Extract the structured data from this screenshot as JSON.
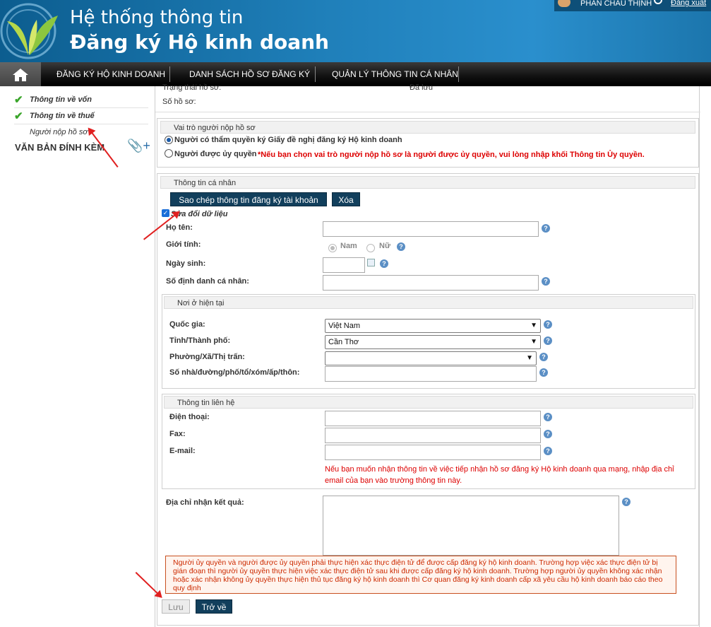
{
  "header": {
    "title_line1": "Hệ thống thông tin",
    "title_line2": "Đăng ký Hộ kinh doanh",
    "user_name": "PHAN CHÂU THỊNH",
    "logout": "Đăng xuất"
  },
  "nav": {
    "home_icon": "home-icon",
    "items": [
      "ĐĂNG KÝ HỘ KINH DOANH",
      "DANH SÁCH HỒ SƠ ĐĂNG KÝ",
      "QUẢN LÝ THÔNG TIN CÁ NHÂN"
    ]
  },
  "sidebar": {
    "items": [
      "Thông tin về vốn",
      "Thông tin về thuế",
      "Người nộp hồ sơ"
    ],
    "attachments": "VĂN BẢN ĐÍNH KÈM"
  },
  "status": {
    "trang_thai_label": "Trạng thái hồ sơ:",
    "trang_thai_value": "Đã lưu",
    "so_ho_so_label": "Số hồ sơ:"
  },
  "role": {
    "legend": "Vai trò người nộp hồ sơ",
    "option1": "Người có thẩm quyền ký Giấy đề nghị đăng ký Hộ kinh doanh",
    "option2": "Người được ủy quyền",
    "note": "*Nếu bạn chọn vai trò người nộp hồ sơ là người được ủy quyền, vui lòng nhập khối Thông tin Ủy quyền."
  },
  "personal": {
    "legend": "Thông tin cá nhân",
    "copy_button": "Sao chép thông tin đăng ký tài khoản",
    "delete_button": "Xóa",
    "edit_checkbox": "Sửa đổi dữ liệu",
    "ho_ten": "Họ tên:",
    "gioi_tinh": "Giới tính:",
    "nam": "Nam",
    "nu": "Nữ",
    "ngay_sinh": "Ngày sinh:",
    "so_dinh_danh": "Số định danh cá nhân:"
  },
  "residence": {
    "legend": "Nơi ở hiện tại",
    "quoc_gia": "Quốc gia:",
    "quoc_gia_value": "Việt Nam",
    "tinh": "Tỉnh/Thành phố:",
    "tinh_value": "Cần Thơ",
    "phuong": "Phường/Xã/Thị trấn:",
    "so_nha": "Số nhà/đường/phố/tổ/xóm/ấp/thôn:"
  },
  "contact": {
    "legend": "Thông tin liên hệ",
    "dien_thoai": "Điện thoại:",
    "fax": "Fax:",
    "email": "E-mail:",
    "email_note": "Nếu bạn muốn nhận thông tin về việc tiếp nhận hồ sơ đăng ký Hộ kinh doanh qua mạng, nhập địa chỉ email của bạn vào trường thông tin này."
  },
  "result": {
    "dia_chi": "Địa chỉ nhận kết quả:"
  },
  "notice": "Người ủy quyền và người được ủy quyền phải thực hiện xác thực điện tử để được cấp đăng ký hộ kinh doanh. Trường hợp việc xác thực điện tử bị gián đoạn thì người ủy quyền thực hiện việc xác thực điện tử sau khi được cấp đăng ký hộ kinh doanh. Trường hợp người ủy quyền không xác nhận hoặc xác nhận không ủy quyền thực hiện thủ tục đăng ký hộ kinh doanh thì Cơ quan đăng ký kinh doanh cấp xã yêu cầu hộ kinh doanh báo cáo theo quy định",
  "actions": {
    "save": "Lưu",
    "back": "Trở về"
  }
}
